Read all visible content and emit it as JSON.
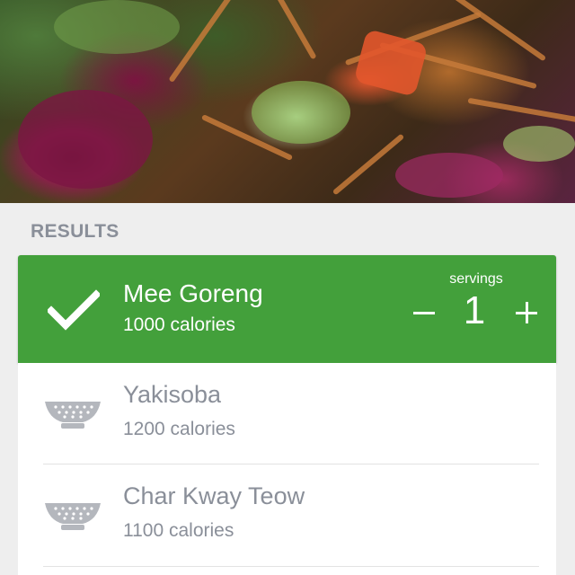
{
  "hero": {
    "icon": "food-photo"
  },
  "results": {
    "heading": "RESULTS",
    "selected": {
      "name": "Mee Goreng",
      "calories": "1000 calories",
      "servings_label": "servings",
      "servings": "1",
      "icon": "check-icon",
      "color": "#43a03b"
    },
    "items": [
      {
        "name": "Yakisoba",
        "calories": "1200 calories",
        "icon": "colander-bowl-icon"
      },
      {
        "name": "Char Kway Teow",
        "calories": "1100 calories",
        "icon": "colander-bowl-icon"
      }
    ]
  }
}
